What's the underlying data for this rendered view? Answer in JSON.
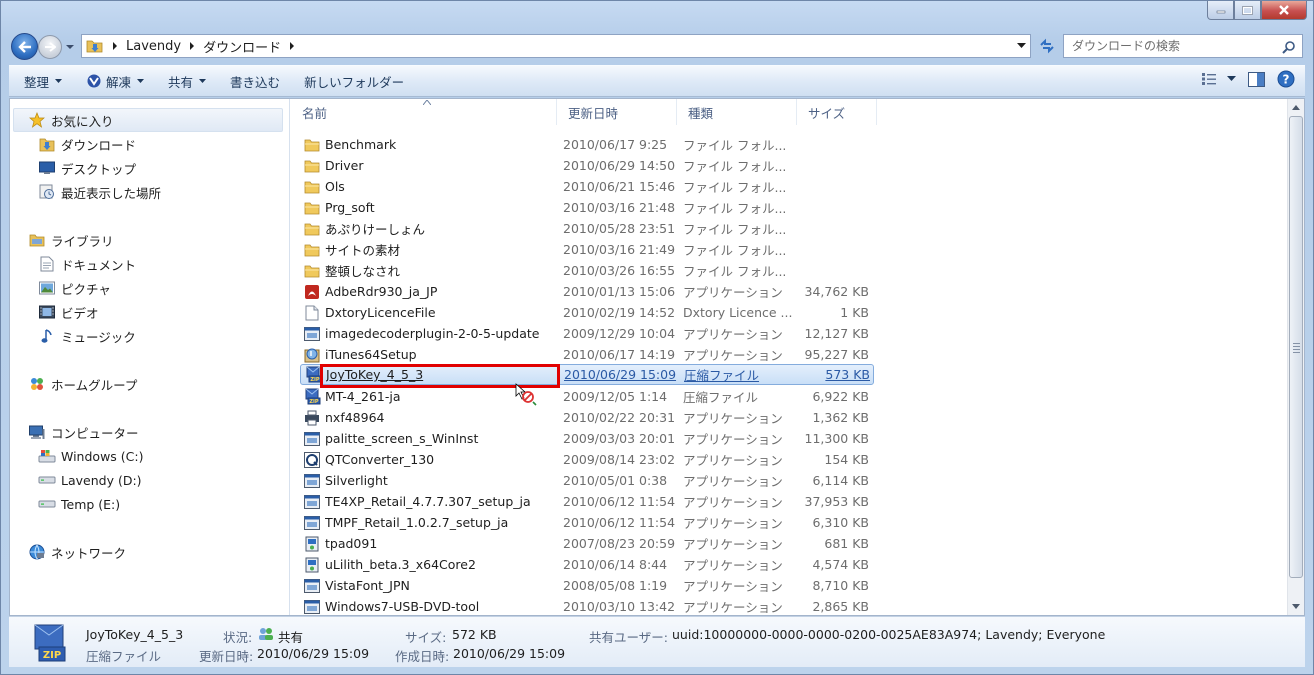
{
  "address": {
    "crumbs": [
      "Lavendy",
      "ダウンロード"
    ],
    "search_placeholder": "ダウンロードの検索"
  },
  "toolbar": {
    "organize": "整理",
    "extract": "解凍",
    "share": "共有",
    "burn": "書き込む",
    "new_folder": "新しいフォルダー"
  },
  "nav": {
    "favorites": "お気に入り",
    "downloads": "ダウンロード",
    "desktop": "デスクトップ",
    "recent": "最近表示した場所",
    "libraries": "ライブラリ",
    "documents": "ドキュメント",
    "pictures": "ピクチャ",
    "videos": "ビデオ",
    "music": "ミュージック",
    "homegroup": "ホームグループ",
    "computer": "コンピューター",
    "drive_c": "Windows (C:)",
    "drive_d": "Lavendy (D:)",
    "drive_e": "Temp (E:)",
    "network": "ネットワーク"
  },
  "columns": {
    "name": "名前",
    "modified": "更新日時",
    "type": "種類",
    "size": "サイズ"
  },
  "files": [
    {
      "icon": "folder-icon",
      "name": "Benchmark",
      "date": "2010/06/17 9:25",
      "type": "ファイル フォル...",
      "size": ""
    },
    {
      "icon": "folder-icon",
      "name": "Driver",
      "date": "2010/06/29 14:50",
      "type": "ファイル フォル...",
      "size": ""
    },
    {
      "icon": "folder-icon",
      "name": "Ols",
      "date": "2010/06/21 15:46",
      "type": "ファイル フォル...",
      "size": ""
    },
    {
      "icon": "folder-icon",
      "name": "Prg_soft",
      "date": "2010/03/16 21:48",
      "type": "ファイル フォル...",
      "size": ""
    },
    {
      "icon": "folder-icon",
      "name": "あぷりけーしょん",
      "date": "2010/05/28 23:51",
      "type": "ファイル フォル...",
      "size": ""
    },
    {
      "icon": "folder-icon",
      "name": "サイトの素材",
      "date": "2010/03/16 21:49",
      "type": "ファイル フォル...",
      "size": ""
    },
    {
      "icon": "folder-icon",
      "name": "整頓しなされ",
      "date": "2010/03/26 16:55",
      "type": "ファイル フォル...",
      "size": ""
    },
    {
      "icon": "pdf-installer-icon",
      "name": "AdbeRdr930_ja_JP",
      "date": "2010/01/13 15:06",
      "type": "アプリケーション",
      "size": "34,762 KB"
    },
    {
      "icon": "document-icon",
      "name": "DxtoryLicenceFile",
      "date": "2010/02/19 14:52",
      "type": "Dxtory Licence ...",
      "size": "1 KB"
    },
    {
      "icon": "app-icon",
      "name": "imagedecoderplugin-2-0-5-update",
      "date": "2009/12/29 10:04",
      "type": "アプリケーション",
      "size": "12,127 KB"
    },
    {
      "icon": "itunes-icon",
      "name": "iTunes64Setup",
      "date": "2010/06/17 14:19",
      "type": "アプリケーション",
      "size": "95,227 KB"
    },
    {
      "icon": "zip-icon",
      "name": "JoyToKey_4_5_3",
      "date": "2010/06/29 15:09",
      "type": "圧縮ファイル",
      "size": "573 KB",
      "selected": true
    },
    {
      "icon": "zip-icon",
      "name": "MT-4_261-ja",
      "date": "2009/12/05 1:14",
      "type": "圧縮ファイル",
      "size": "6,922 KB"
    },
    {
      "icon": "printer-app-icon",
      "name": "nxf48964",
      "date": "2010/02/22 20:31",
      "type": "アプリケーション",
      "size": "1,362 KB"
    },
    {
      "icon": "app-icon",
      "name": "palitte_screen_s_WinInst",
      "date": "2009/03/03 20:01",
      "type": "アプリケーション",
      "size": "11,300 KB"
    },
    {
      "icon": "qt-icon",
      "name": "QTConverter_130",
      "date": "2009/08/14 23:02",
      "type": "アプリケーション",
      "size": "154 KB"
    },
    {
      "icon": "app-icon",
      "name": "Silverlight",
      "date": "2010/05/01 0:38",
      "type": "アプリケーション",
      "size": "6,114 KB"
    },
    {
      "icon": "app-icon",
      "name": "TE4XP_Retail_4.7.7.307_setup_ja",
      "date": "2010/06/12 11:54",
      "type": "アプリケーション",
      "size": "37,953 KB"
    },
    {
      "icon": "app-icon",
      "name": "TMPF_Retail_1.0.2.7_setup_ja",
      "date": "2010/06/12 11:54",
      "type": "アプリケーション",
      "size": "6,310 KB"
    },
    {
      "icon": "installer-icon",
      "name": "tpad091",
      "date": "2007/08/23 20:59",
      "type": "アプリケーション",
      "size": "681 KB"
    },
    {
      "icon": "installer-icon",
      "name": "uLilith_beta.3_x64Core2",
      "date": "2010/06/14 8:44",
      "type": "アプリケーション",
      "size": "4,574 KB"
    },
    {
      "icon": "app-icon",
      "name": "VistaFont_JPN",
      "date": "2008/05/08 1:19",
      "type": "アプリケーション",
      "size": "8,710 KB"
    },
    {
      "icon": "app-icon",
      "name": "Windows7-USB-DVD-tool",
      "date": "2010/03/10 13:42",
      "type": "アプリケーション",
      "size": "2,865 KB"
    }
  ],
  "details": {
    "name": "JoyToKey_4_5_3",
    "kind": "圧縮ファイル",
    "state_label": "状況:",
    "state_value": "共有",
    "modified_label": "更新日時:",
    "modified_value": "2010/06/29 15:09",
    "size_label": "サイズ:",
    "size_value": "572 KB",
    "created_label": "作成日時:",
    "created_value": "2010/06/29 15:09",
    "shared_label": "共有ユーザー:",
    "shared_value": "uuid:10000000-0000-0000-0200-0025AE83A974; Lavendy; Everyone",
    "zip_badge": "ZIP"
  }
}
